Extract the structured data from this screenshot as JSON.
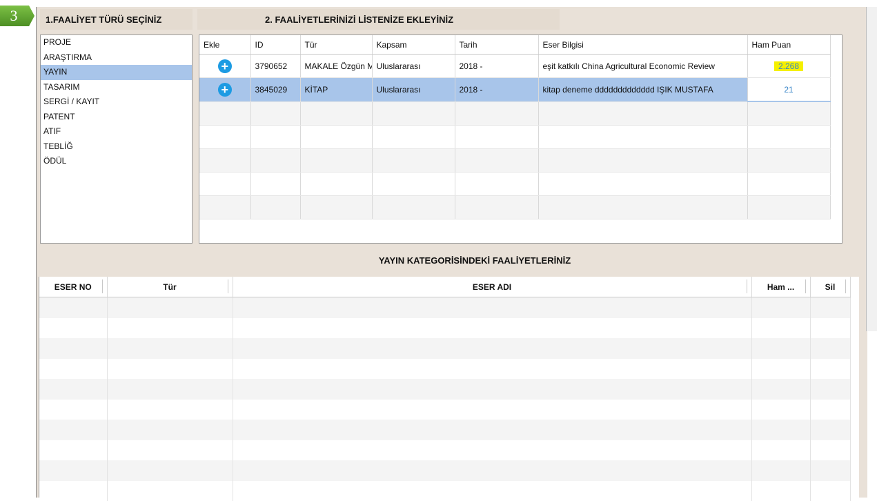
{
  "step": {
    "number": "3",
    "color": "#5aa02c"
  },
  "section1": {
    "title": "1.FAALİYET TÜRÜ SEÇİNİZ"
  },
  "section2": {
    "title": "2. FAALİYETLERİNİZİ LİSTENİZE EKLEYİNİZ"
  },
  "categories": [
    {
      "label": "PROJE",
      "selected": false
    },
    {
      "label": "ARAŞTIRMA",
      "selected": false
    },
    {
      "label": "YAYIN",
      "selected": true
    },
    {
      "label": "TASARIM",
      "selected": false
    },
    {
      "label": "SERGİ / KAYIT",
      "selected": false
    },
    {
      "label": "PATENT",
      "selected": false
    },
    {
      "label": "ATIF",
      "selected": false
    },
    {
      "label": "TEBLİĞ",
      "selected": false
    },
    {
      "label": "ÖDÜL",
      "selected": false
    }
  ],
  "activity_table": {
    "headers": [
      "Ekle",
      "ID",
      "Tür",
      "Kapsam",
      "Tarih",
      "Eser Bilgisi",
      "Ham Puan"
    ],
    "rows": [
      {
        "add_icon": "plus-circle-icon",
        "id": "3790652",
        "tur": "MAKALE Özgün Makale",
        "kapsam": "Uluslararası",
        "tarih": "2018 -",
        "eser": "eşit katkılı China Agricultural Economic Review",
        "puan": "2.268",
        "highlight": true
      },
      {
        "add_icon": "plus-circle-icon",
        "id": "3845029",
        "tur": "KİTAP",
        "kapsam": "Uluslararası",
        "tarih": "2018 -",
        "eser": "kitap deneme ddddddddddddd IŞIK MUSTAFA",
        "puan": "21",
        "highlight": false
      }
    ]
  },
  "bottom": {
    "title": "YAYIN KATEGORİSİNDEKİ FAALİYETLERİNİZ",
    "headers": [
      "ESER NO",
      "Tür",
      "ESER ADI",
      "Ham ...",
      "Sil"
    ]
  },
  "colors": {
    "selection": "#a8c5ea",
    "highlight": "#f5f000",
    "add_button": "#1c9be3",
    "panel": "#e9e1d8"
  }
}
